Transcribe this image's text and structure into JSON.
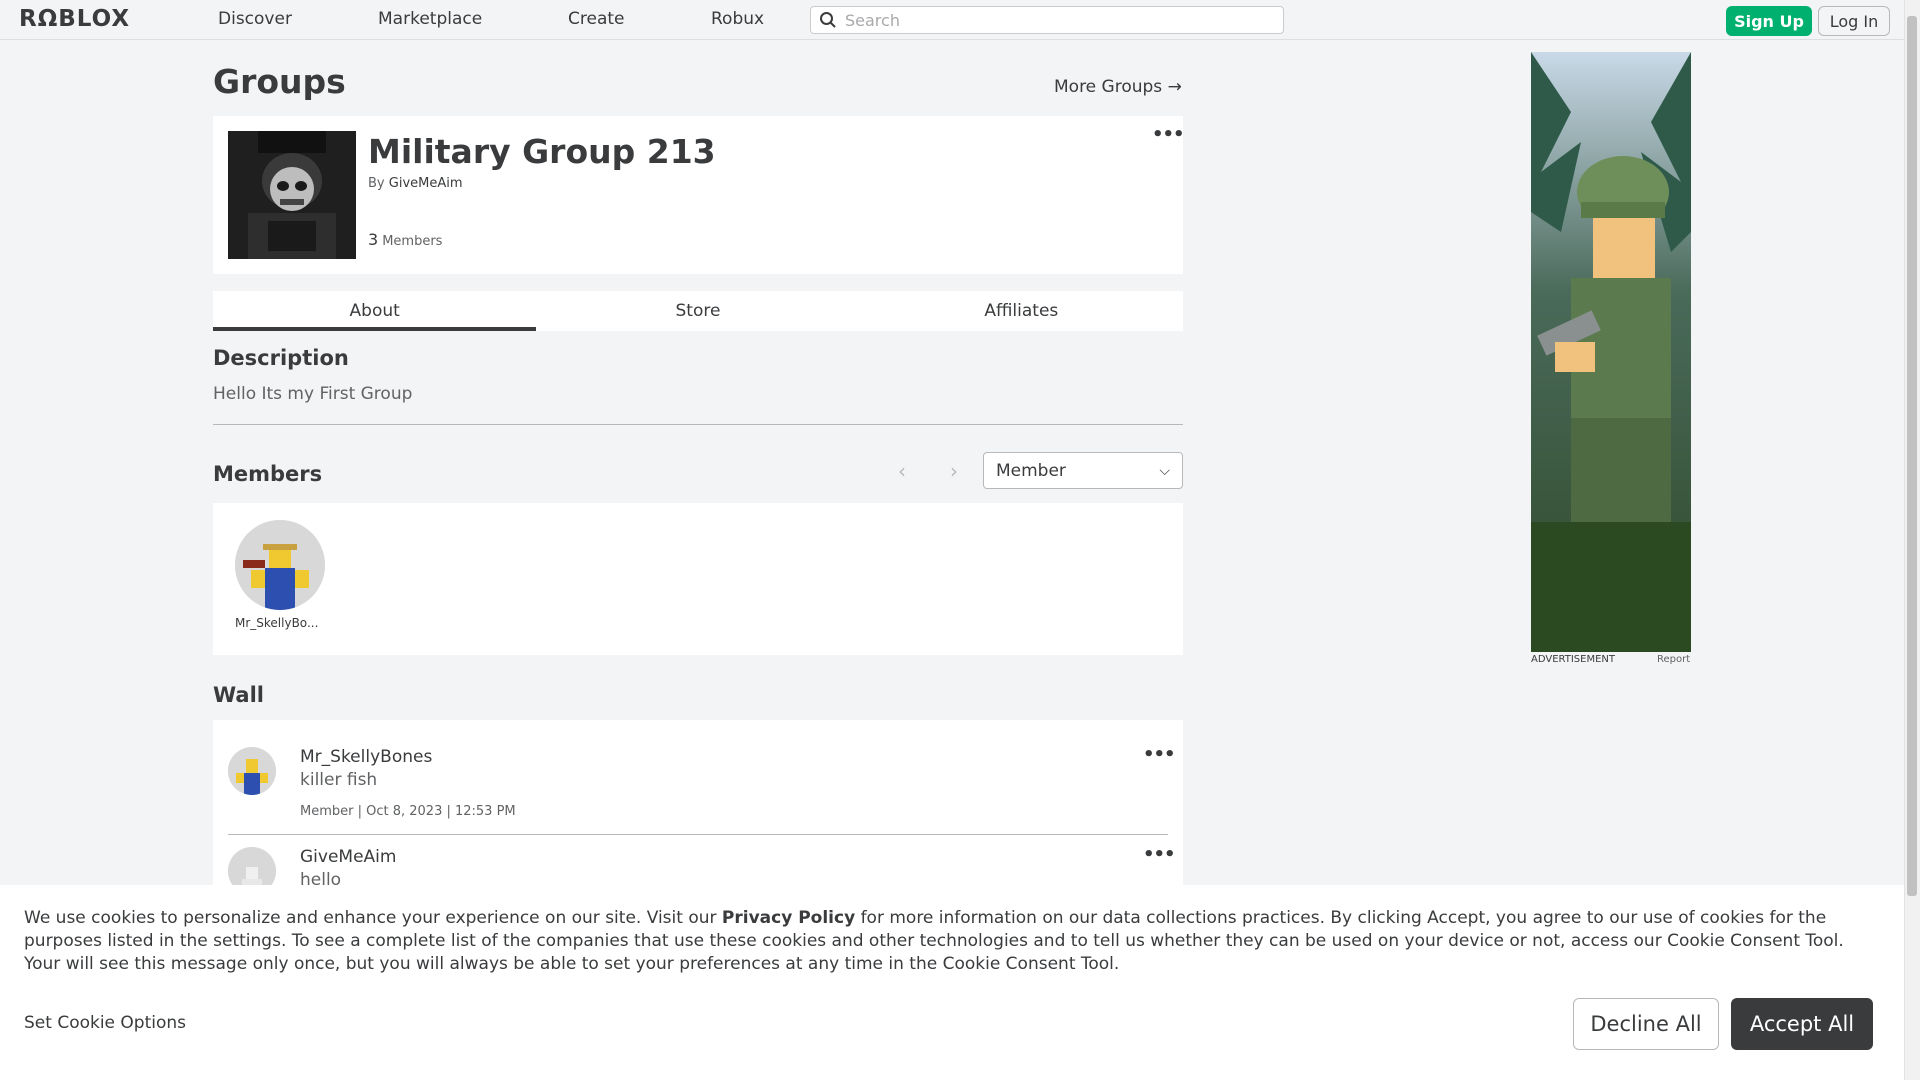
{
  "nav": {
    "logo": "RΩBLOX",
    "links": [
      "Discover",
      "Marketplace",
      "Create",
      "Robux"
    ],
    "search_placeholder": "Search",
    "signup_label": "Sign Up",
    "login_label": "Log In"
  },
  "page": {
    "title": "Groups",
    "more_groups": "More Groups →"
  },
  "group": {
    "name": "Military Group 213",
    "by_label": "By",
    "owner": "GiveMeAim",
    "member_count": "3",
    "members_label": "Members"
  },
  "tabs": [
    "About",
    "Store",
    "Affiliates"
  ],
  "description": {
    "heading": "Description",
    "text": "Hello Its my First Group"
  },
  "members": {
    "heading": "Members",
    "role_selected": "Member",
    "list": [
      {
        "name": "Mr_SkellyBo..."
      }
    ]
  },
  "wall": {
    "heading": "Wall",
    "posts": [
      {
        "user": "Mr_SkellyBones",
        "body": "killer fish",
        "meta": "Member | Oct 8, 2023 | 12:53 PM"
      },
      {
        "user": "GiveMeAim",
        "body": "hello",
        "meta": ""
      }
    ]
  },
  "ad": {
    "label": "ADVERTISEMENT",
    "report": "Report"
  },
  "cookie": {
    "text_before": "We use cookies to personalize and enhance your experience on our site. Visit our ",
    "link": "Privacy Policy",
    "text_after": " for more information on our data collections practices. By clicking Accept, you agree to our use of cookies for the purposes listed in the settings. To see a complete list of the companies that use these cookies and other technologies and to tell us whether they can be used on your device or not, access our Cookie Consent Tool. Your will see this message only once, but you will always be able to set your preferences at any time in the Cookie Consent Tool.",
    "options": "Set Cookie Options",
    "decline": "Decline All",
    "accept": "Accept All"
  },
  "colors": {
    "accent_green": "#00b06f",
    "dark": "#393b3d",
    "background": "#f2f4f5"
  }
}
